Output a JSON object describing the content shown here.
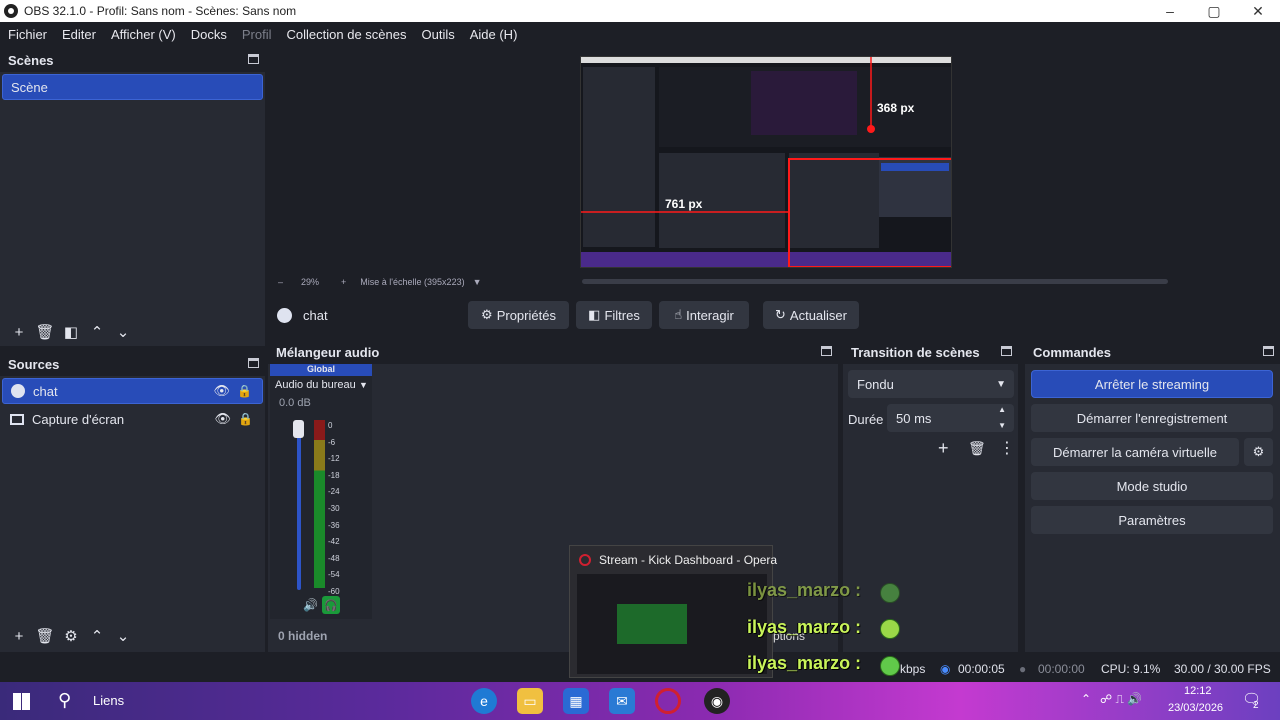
{
  "window": {
    "title": "OBS 32.1.0 - Profil: Sans nom - Scènes: Sans nom",
    "controls": {
      "minimize": "–",
      "maximize": "▢",
      "close": "✕"
    }
  },
  "menu": [
    "Fichier",
    "Editer",
    "Afficher (V)",
    "Docks",
    "Profil",
    "Collection de scènes",
    "Outils",
    "Aide (H)"
  ],
  "scenes": {
    "title": "Scènes",
    "items": [
      "Scène"
    ]
  },
  "sources": {
    "title": "Sources",
    "items": [
      {
        "label": "chat",
        "icon": "globe-icon"
      },
      {
        "label": "Capture d'écran",
        "icon": "monitor-icon"
      }
    ]
  },
  "preview": {
    "zoom": "29%",
    "scale_label": "Mise à l'échelle (395x223)",
    "width_marker": "761 px",
    "height_marker": "368 px"
  },
  "source_toolbar": {
    "source_name": "chat",
    "properties": "Propriétés",
    "filters": "Filtres",
    "interact": "Interagir",
    "refresh": "Actualiser"
  },
  "audio_mixer": {
    "title": "Mélangeur audio",
    "global_label": "Global",
    "channel_name": "Audio du bureau",
    "level": "0.0 dB",
    "scale": [
      "0",
      "-6",
      "-12",
      "-18",
      "-24",
      "-30",
      "-36",
      "-42",
      "-48",
      "-54",
      "-60"
    ],
    "hidden": "0 hidden"
  },
  "transition": {
    "title": "Transition de scènes",
    "type": "Fondu",
    "duration_label": "Durée",
    "duration_value": "50 ms"
  },
  "controls": {
    "title": "Commandes",
    "stop_stream": "Arrêter le streaming",
    "start_record": "Démarrer l'enregistrement",
    "virtual_cam": "Démarrer la caméra virtuelle",
    "studio_mode": "Mode studio",
    "settings": "Paramètres"
  },
  "popup": {
    "title": "Stream - Kick Dashboard - Opera",
    "partial_text": "ptions"
  },
  "chat_overlay": {
    "username": "ilyas_marzo :"
  },
  "status": {
    "kbps": "kbps",
    "stream_time": "00:00:05",
    "record_time": "00:00:00",
    "cpu": "CPU: 9.1%",
    "fps": "30.00 / 30.00 FPS"
  },
  "taskbar": {
    "search_label": "Liens",
    "time": "12:12",
    "date": "23/03/2026",
    "notif_count": "2"
  },
  "colors": {
    "accent": "#284cb8",
    "panel": "#272a33",
    "bg": "#1d1f26",
    "chat_name": "#c9f45a"
  }
}
